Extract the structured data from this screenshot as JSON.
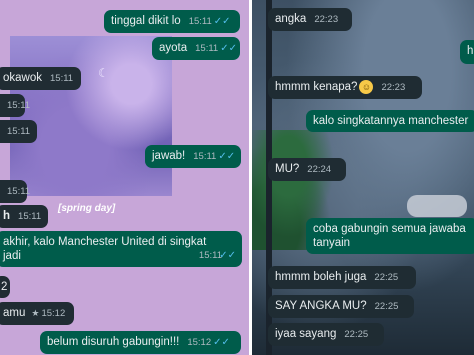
{
  "left_chat": {
    "caption": "[spring day]",
    "messages": [
      {
        "text": "tinggal dikit lo",
        "time": "15:11",
        "dir": "out"
      },
      {
        "text": "ayota",
        "time": "15:11",
        "dir": "out"
      },
      {
        "text": "okawok",
        "time": "15:11",
        "dir": "in"
      },
      {
        "text": "",
        "time": "15:11",
        "dir": "in"
      },
      {
        "text": "",
        "time": "15:11",
        "dir": "in"
      },
      {
        "text": "jawab!",
        "time": "15:11",
        "dir": "out"
      },
      {
        "text": "",
        "time": "15:11",
        "dir": "in"
      },
      {
        "text": "h",
        "time": "15:11",
        "dir": "in"
      },
      {
        "text": "akhir, kalo Manchester United di singkat",
        "text2": "jadi",
        "time": "15:11",
        "dir": "out"
      },
      {
        "text": "2",
        "time": "",
        "dir": "in"
      },
      {
        "text": "amu",
        "time": "15:12",
        "dir": "in"
      },
      {
        "text": "belum disuruh gabungin!!!",
        "time": "15:12",
        "dir": "out"
      }
    ]
  },
  "right_chat": {
    "messages": [
      {
        "text": "angka",
        "time": "22:23",
        "dir": "in"
      },
      {
        "text": "h",
        "time": "",
        "dir": "out"
      },
      {
        "text": "hmmm kenapa?",
        "time": "22:23",
        "dir": "in"
      },
      {
        "text": "kalo singkatannya manchester",
        "time": "",
        "dir": "out"
      },
      {
        "text": "MU?",
        "time": "22:24",
        "dir": "in"
      },
      {
        "text": "coba gabungin semua jawaba",
        "text2": "tanyain",
        "time": "",
        "dir": "out"
      },
      {
        "text": "hmmm boleh juga",
        "time": "22:25",
        "dir": "in"
      },
      {
        "text": "SAY ANGKA MU?",
        "time": "22:25",
        "dir": "in"
      },
      {
        "text": "iyaa sayang",
        "time": "22:25",
        "dir": "in"
      }
    ]
  },
  "icons": {
    "read_ticks": "double-check",
    "starred": "star",
    "moon": "crescent-moon",
    "emoji": "grimacing-face"
  }
}
